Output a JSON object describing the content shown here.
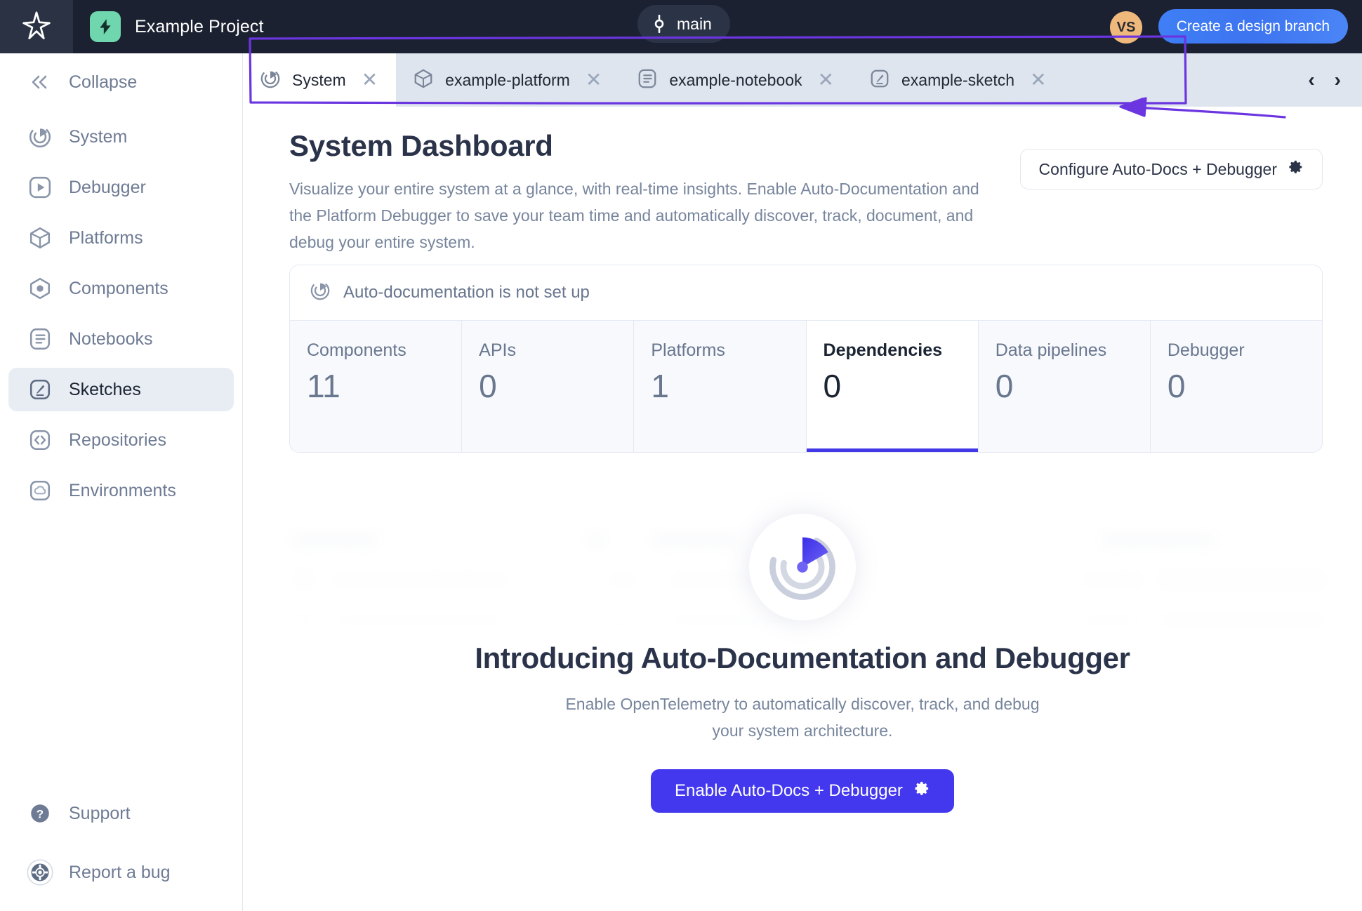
{
  "topbar": {
    "app_logo_icon": "star-sparkle-icon",
    "project_badge_icon": "lightning-bolt-icon",
    "project_name": "Example Project",
    "branch_icon": "git-branch-icon",
    "branch_name": "main",
    "avatar_initials": "VS",
    "create_branch_label": "Create a design branch",
    "accent_blue": "#3d74f0",
    "badge_green": "#6fd6ad",
    "avatar_orange": "#f0b97c"
  },
  "sidebar": {
    "collapse": {
      "label": "Collapse",
      "icon": "chevrons-left-icon"
    },
    "items": [
      {
        "label": "System",
        "icon": "radar-icon",
        "active": false
      },
      {
        "label": "Debugger",
        "icon": "play-square-icon",
        "active": false
      },
      {
        "label": "Platforms",
        "icon": "cube-icon",
        "active": false
      },
      {
        "label": "Components",
        "icon": "hexagon-dot-icon",
        "active": false
      },
      {
        "label": "Notebooks",
        "icon": "notebook-icon",
        "active": false
      },
      {
        "label": "Sketches",
        "icon": "sketch-pen-icon",
        "active": true
      },
      {
        "label": "Repositories",
        "icon": "code-brackets-icon",
        "active": false
      },
      {
        "label": "Environments",
        "icon": "cloud-icon",
        "active": false
      }
    ],
    "bottom": [
      {
        "label": "Support",
        "icon": "question-circle-icon"
      },
      {
        "label": "Report a bug",
        "icon": "lifebuoy-icon"
      }
    ]
  },
  "tabs": {
    "items": [
      {
        "label": "System",
        "icon": "radar-icon",
        "active": true
      },
      {
        "label": "example-platform",
        "icon": "cube-icon",
        "active": false
      },
      {
        "label": "example-notebook",
        "icon": "notebook-icon",
        "active": false
      },
      {
        "label": "example-sketch",
        "icon": "sketch-pen-icon",
        "active": false
      }
    ],
    "close_glyph": "✕",
    "prev_glyph": "‹",
    "next_glyph": "›"
  },
  "page": {
    "title": "System Dashboard",
    "description": "Visualize your entire system at a glance, with real-time insights. Enable Auto-Documentation and the Platform Debugger to save your team time and automatically discover, track, document, and debug your entire system.",
    "configure_button": {
      "label": "Configure Auto-Docs + Debugger",
      "icon": "gear-icon"
    }
  },
  "stats_card": {
    "header": {
      "label": "Auto-documentation is not set up",
      "icon": "radar-icon"
    },
    "tiles": [
      {
        "label": "Components",
        "value": "11",
        "selected": false
      },
      {
        "label": "APIs",
        "value": "0",
        "selected": false
      },
      {
        "label": "Platforms",
        "value": "1",
        "selected": false
      },
      {
        "label": "Dependencies",
        "value": "0",
        "selected": true
      },
      {
        "label": "Data pipelines",
        "value": "0",
        "selected": false
      },
      {
        "label": "Debugger",
        "value": "0",
        "selected": false
      }
    ],
    "selected_underline_color": "#4338e8"
  },
  "promo": {
    "logo_icon": "radar-logo-icon",
    "heading": "Introducing Auto-Documentation and Debugger",
    "body": "Enable OpenTelemetry to automatically discover, track, and debug your system architecture.",
    "button": {
      "label": "Enable Auto-Docs + Debugger",
      "icon": "gear-icon",
      "color": "#4338ee"
    }
  },
  "annotation": {
    "shape": "hand-drawn-rectangle-with-arrow",
    "color": "#6b35e0"
  }
}
